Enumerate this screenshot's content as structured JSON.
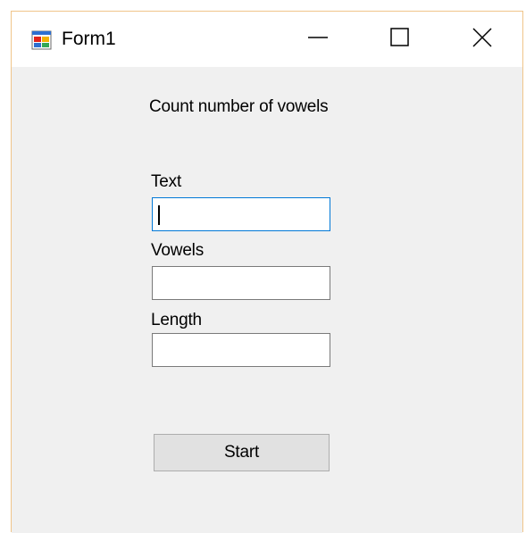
{
  "window": {
    "title": "Form1",
    "icon": "winforms-app-icon",
    "controls": {
      "minimize": "minimize-icon",
      "maximize": "maximize-icon",
      "close": "close-icon"
    },
    "accent_border": "#f0c58a"
  },
  "form": {
    "heading": "Count number of vowels",
    "fields": {
      "text": {
        "label": "Text",
        "value": ""
      },
      "vowels": {
        "label": "Vowels",
        "value": ""
      },
      "length": {
        "label": "Length",
        "value": ""
      }
    },
    "start_label": "Start"
  },
  "colors": {
    "focus_border": "#0078d7",
    "client_background": "#f0f0f0",
    "button_background": "#e1e1e1"
  }
}
